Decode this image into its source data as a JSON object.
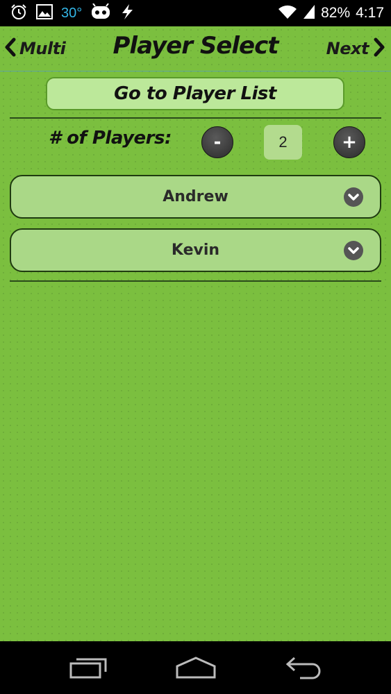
{
  "status_bar": {
    "temperature": "30°",
    "battery": "82%",
    "time": "4:17"
  },
  "header": {
    "back_label": "Multi",
    "title": "Player Select",
    "next_label": "Next"
  },
  "goto_button_label": "Go to Player List",
  "players": {
    "label": "# of Players:",
    "minus_label": "-",
    "plus_label": "+",
    "count": "2"
  },
  "player_slots": [
    {
      "name": "Andrew"
    },
    {
      "name": "Kevin"
    }
  ],
  "colors": {
    "background": "#7bbf3f",
    "button_fill": "#bce89a",
    "slot_fill": "#aad887",
    "accent_blue": "#33b5e5"
  }
}
